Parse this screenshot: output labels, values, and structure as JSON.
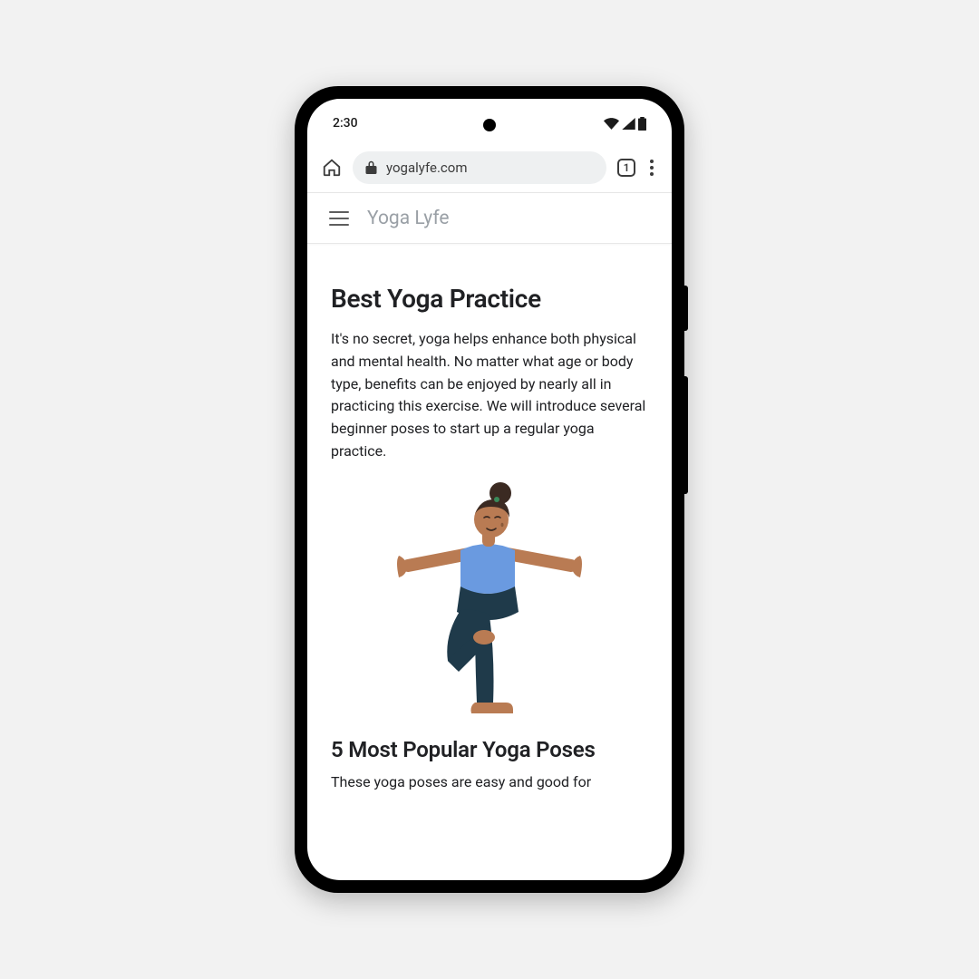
{
  "status": {
    "time": "2:30"
  },
  "browser": {
    "url": "yogalyfe.com",
    "tab_count": "1"
  },
  "site": {
    "name": "Yoga Lyfe"
  },
  "article": {
    "heading": "Best Yoga Practice",
    "intro": "It's no secret, yoga helps enhance both physical and mental health. No matter what age or body type, benefits can be enjoyed by nearly all in practicing this exercise. We will introduce several beginner poses  to start up a regular yoga practice.",
    "subheading": "5 Most Popular Yoga Poses",
    "subintro": "These yoga poses are easy and good for"
  }
}
